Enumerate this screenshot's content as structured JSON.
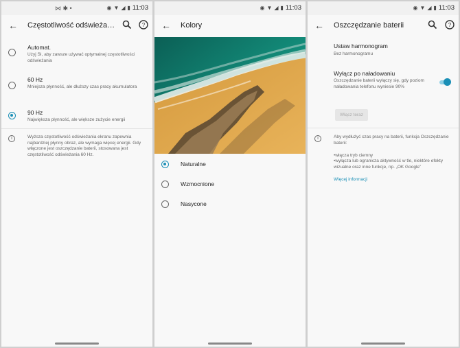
{
  "status": {
    "time": "11:03"
  },
  "screens": [
    {
      "title": "Częstotliwość odświeża…",
      "options": [
        {
          "title": "Automat.",
          "subtitle": "Użyj SI, aby zawsze używać optymalnej częstotliwości odświeżania",
          "selected": false
        },
        {
          "title": "60 Hz",
          "subtitle": "Mniejsza płynność, ale dłuższy czas pracy akumulatora",
          "selected": false
        },
        {
          "title": "90 Hz",
          "subtitle": "Największa płynność, ale większe zużycie energii",
          "selected": true
        }
      ],
      "info": "Wyższa częstotliwość odświeżania ekranu zapewnia najbardziej płynny obraz, ale wymaga więcej energii. Gdy włączone jest oszczędzanie baterii, stosowana jest częstotliwość odświeżania 60 Hz."
    },
    {
      "title": "Kolory",
      "options": [
        {
          "label": "Naturalne",
          "selected": true
        },
        {
          "label": "Wzmocnione",
          "selected": false
        },
        {
          "label": "Nasycone",
          "selected": false
        }
      ]
    },
    {
      "title": "Oszczędzanie baterii",
      "schedule": {
        "title": "Ustaw harmonogram",
        "subtitle": "Bez harmonogramu"
      },
      "auto_off": {
        "title": "Wyłącz po naładowaniu",
        "subtitle": "Oszczędzanie baterii wyłączy się, gdy poziom naładowania telefonu wyniesie 90%",
        "enabled": true
      },
      "turn_on_button": "Włącz teraz",
      "info_line1": "Aby wydłużyć czas pracy na baterii, funkcja Oszczędzanie baterii:",
      "info_bullet1": "•włącza tryb ciemny",
      "info_bullet2": "•wyłącza lub ogranicza aktywność w tle, niektóre efekty wizualne oraz inne funkcje, np. „OK Google”",
      "more_link": "Więcej informacji"
    }
  ],
  "colors": {
    "accent": "#1a8fb6"
  }
}
